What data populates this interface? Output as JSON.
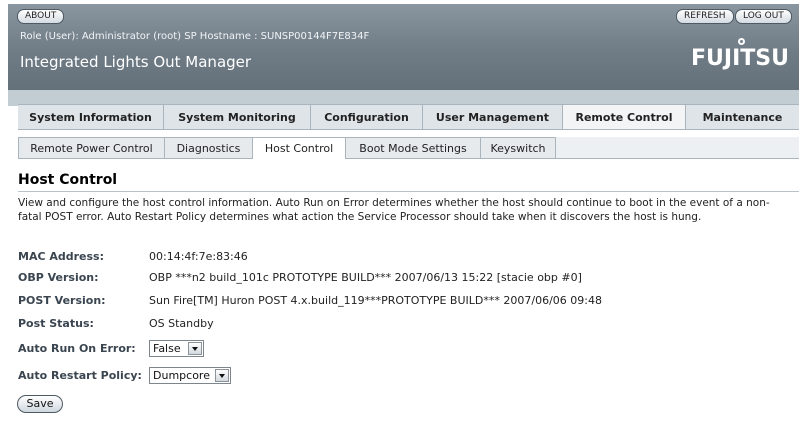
{
  "header": {
    "about_label": "ABOUT",
    "refresh_label": "REFRESH",
    "logout_label": "LOG OUT",
    "role_text": "Role (User): Administrator (root)   SP Hostname : SUNSP00144F7E834F",
    "app_title": "Integrated Lights Out Manager",
    "logo_text": "FUJITSU"
  },
  "main_tabs": [
    {
      "label": "System Information",
      "active": false
    },
    {
      "label": "System Monitoring",
      "active": false
    },
    {
      "label": "Configuration",
      "active": false
    },
    {
      "label": "User Management",
      "active": false
    },
    {
      "label": "Remote Control",
      "active": true
    },
    {
      "label": "Maintenance",
      "active": false
    }
  ],
  "sub_tabs": [
    {
      "label": "Remote Power Control",
      "active": false
    },
    {
      "label": "Diagnostics",
      "active": false
    },
    {
      "label": "Host Control",
      "active": true
    },
    {
      "label": "Boot Mode Settings",
      "active": false
    },
    {
      "label": "Keyswitch",
      "active": false
    }
  ],
  "page": {
    "title": "Host Control",
    "description": "View and configure the host control information. Auto Run on Error determines whether the host should continue to boot in the event of a non-fatal POST error. Auto Restart Policy determines what action the Service Processor should take when it discovers the host is hung."
  },
  "fields": {
    "mac": {
      "label": "MAC Address:",
      "value": "00:14:4f:7e:83:46"
    },
    "obp": {
      "label": "OBP Version:",
      "value": "OBP ***n2 build_101c PROTOTYPE BUILD*** 2007/06/13 15:22 [stacie obp #0]"
    },
    "post": {
      "label": "POST Version:",
      "value": "Sun Fire[TM] Huron POST 4.x.build_119***PROTOTYPE BUILD*** 2007/06/06 09:48"
    },
    "post_status": {
      "label": "Post Status:",
      "value": "OS Standby"
    },
    "auto_run": {
      "label": "Auto Run On Error:",
      "value": "False"
    },
    "auto_restart": {
      "label": "Auto Restart Policy:",
      "value": "Dumpcore"
    }
  },
  "save_label": "Save",
  "colors": {
    "header_bg": "#6f7c86",
    "tab_bg": "#dfe4e8",
    "active_tab_bg": "#f2f4f6",
    "label_color": "#3a4550"
  }
}
